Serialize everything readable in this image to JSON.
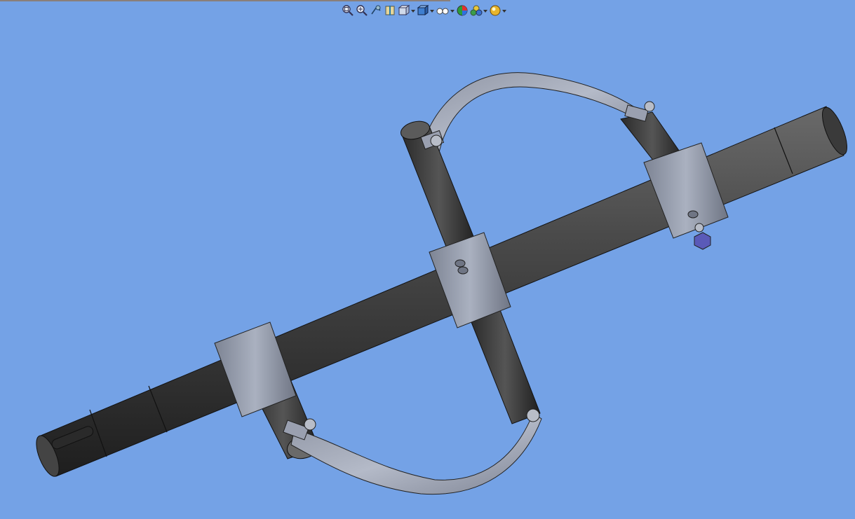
{
  "window": {
    "background": "#74a2e6"
  },
  "heads_up_toolbar": {
    "buttons": [
      {
        "id": "zoom-to-fit",
        "icon": "zoom-to-fit-icon",
        "has_dropdown": false
      },
      {
        "id": "zoom-to-area",
        "icon": "zoom-to-area-icon",
        "has_dropdown": false
      },
      {
        "id": "previous-view",
        "icon": "previous-view-icon",
        "has_dropdown": false
      },
      {
        "id": "section-view",
        "icon": "section-view-icon",
        "has_dropdown": false
      },
      {
        "id": "view-orientation",
        "icon": "view-orientation-icon",
        "has_dropdown": true
      },
      {
        "id": "display-style",
        "icon": "display-style-icon",
        "has_dropdown": true
      },
      {
        "id": "hide-show-items",
        "icon": "hide-show-items-icon",
        "has_dropdown": true
      },
      {
        "id": "edit-appearance",
        "icon": "edit-appearance-icon",
        "has_dropdown": false
      },
      {
        "id": "apply-scene",
        "icon": "apply-scene-icon",
        "has_dropdown": true
      },
      {
        "id": "view-settings",
        "icon": "view-settings-icon",
        "has_dropdown": true
      }
    ]
  },
  "model": {
    "parts": [
      "main-shaft",
      "center-collar",
      "end-collar-left",
      "end-collar-right",
      "cross-rod",
      "curved-strap-upper",
      "curved-strap-lower",
      "hex-nut"
    ],
    "colors": {
      "shaft": "#3c3c3c",
      "collar": "#8e96a6",
      "strap": "#9aa0b0",
      "nut": "#5a5ab8"
    }
  }
}
